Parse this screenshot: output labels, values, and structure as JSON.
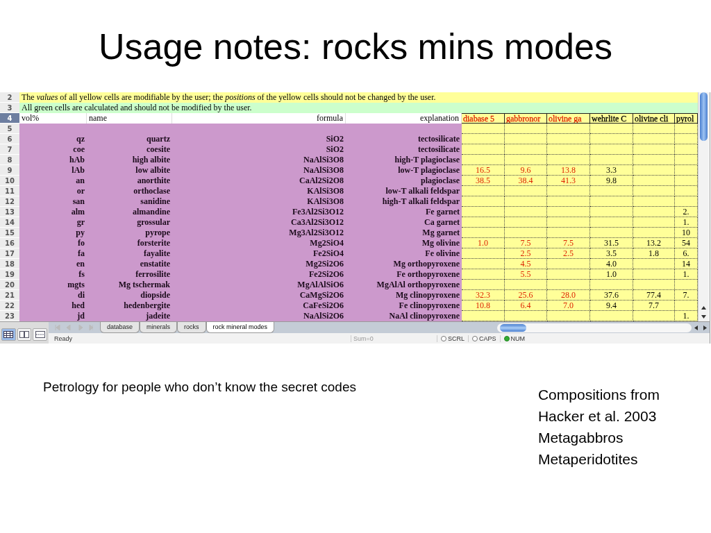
{
  "slide": {
    "title": "Usage notes: rocks mins modes",
    "caption": "Petrology for people who don’t know the secret codes",
    "side_notes": [
      "Compositions from",
      "Hacker et al. 2003",
      "Metagabbros",
      "Metaperidotites"
    ]
  },
  "sheet": {
    "notes": [
      {
        "row": "2",
        "kind": "yellow",
        "text": "The *values* of all yellow cells are modifiable by the user; the *positions* of the yellow cells should not be changed by the user."
      },
      {
        "row": "3",
        "kind": "green",
        "text": "All green cells are calculated and should not be modified by the user."
      }
    ],
    "header": {
      "row": "4",
      "selected": true,
      "cells": [
        "vol%",
        "name",
        "formula",
        "explanation"
      ],
      "modes": [
        {
          "label": "diabase 5",
          "color": "#dd2200"
        },
        {
          "label": "gabbronor",
          "color": "#dd2200"
        },
        {
          "label": "olivine ga",
          "color": "#dd2200"
        },
        {
          "label": "wehrlite C",
          "color": "#000000"
        },
        {
          "label": "olivine cli",
          "color": "#000000"
        },
        {
          "label": "pyrol",
          "color": "#000000"
        }
      ]
    },
    "rows": [
      {
        "row": "5",
        "modes": [
          {
            "kind": "blank"
          },
          {
            "kind": "blank"
          },
          {
            "kind": "blank"
          },
          {
            "kind": "blank"
          },
          {
            "kind": "blank"
          },
          {
            "kind": "blank"
          }
        ]
      },
      {
        "row": "6",
        "abbr": "qz",
        "name": "quartz",
        "formula": "SiO2",
        "explanation": "tectosilicate",
        "modes": [
          {
            "kind": "blank"
          },
          {
            "kind": "blank"
          },
          {
            "kind": "blank"
          },
          {
            "kind": "blank"
          },
          {
            "kind": "blank"
          },
          {
            "kind": "blank"
          }
        ]
      },
      {
        "row": "7",
        "abbr": "coe",
        "name": "coesite",
        "formula": "SiO2",
        "explanation": "tectosilicate",
        "modes": [
          {
            "kind": "blank"
          },
          {
            "kind": "blank"
          },
          {
            "kind": "blank"
          },
          {
            "kind": "blank"
          },
          {
            "kind": "blank"
          },
          {
            "kind": "blank"
          }
        ]
      },
      {
        "row": "8",
        "abbr": "hAb",
        "name": "high albite",
        "formula": "NaAlSi3O8",
        "explanation": "high-T plagioclase",
        "modes": [
          {
            "kind": "blank"
          },
          {
            "kind": "blank"
          },
          {
            "kind": "blank"
          },
          {
            "kind": "blank"
          },
          {
            "kind": "blank"
          },
          {
            "kind": "blank"
          }
        ]
      },
      {
        "row": "9",
        "abbr": "lAb",
        "name": "low albite",
        "formula": "NaAlSi3O8",
        "explanation": "low-T plagioclase",
        "modes": [
          {
            "kind": "number",
            "value": "16.5"
          },
          {
            "kind": "number",
            "value": "9.6"
          },
          {
            "kind": "number",
            "value": "13.8"
          },
          {
            "kind": "number",
            "value": "3.3"
          },
          {
            "kind": "blank"
          },
          {
            "kind": "blank"
          }
        ]
      },
      {
        "row": "10",
        "abbr": "an",
        "name": "anorthite",
        "formula": "CaAl2Si2O8",
        "explanation": "plagioclase",
        "modes": [
          {
            "kind": "number",
            "value": "38.5"
          },
          {
            "kind": "number",
            "value": "38.4"
          },
          {
            "kind": "number",
            "value": "41.3"
          },
          {
            "kind": "number",
            "value": "9.8"
          },
          {
            "kind": "blank"
          },
          {
            "kind": "blank"
          }
        ]
      },
      {
        "row": "11",
        "abbr": "or",
        "name": "orthoclase",
        "formula": "KAlSi3O8",
        "explanation": "low-T alkali feldspar",
        "modes": [
          {
            "kind": "blank"
          },
          {
            "kind": "blank"
          },
          {
            "kind": "blank"
          },
          {
            "kind": "blank"
          },
          {
            "kind": "blank"
          },
          {
            "kind": "blank"
          }
        ]
      },
      {
        "row": "12",
        "abbr": "san",
        "name": "sanidine",
        "formula": "KAlSi3O8",
        "explanation": "high-T alkali feldspar",
        "modes": [
          {
            "kind": "blank"
          },
          {
            "kind": "blank"
          },
          {
            "kind": "blank"
          },
          {
            "kind": "blank"
          },
          {
            "kind": "blank"
          },
          {
            "kind": "blank"
          }
        ]
      },
      {
        "row": "13",
        "abbr": "alm",
        "name": "almandine",
        "formula": "Fe3Al2Si3O12",
        "explanation": "Fe garnet",
        "modes": [
          {
            "kind": "blank"
          },
          {
            "kind": "blank"
          },
          {
            "kind": "blank"
          },
          {
            "kind": "blank"
          },
          {
            "kind": "blank"
          },
          {
            "kind": "number",
            "value": "2."
          }
        ]
      },
      {
        "row": "14",
        "abbr": "gr",
        "name": "grossular",
        "formula": "Ca3Al2Si3O12",
        "explanation": "Ca garnet",
        "modes": [
          {
            "kind": "blank"
          },
          {
            "kind": "blank"
          },
          {
            "kind": "blank"
          },
          {
            "kind": "blank"
          },
          {
            "kind": "blank"
          },
          {
            "kind": "number",
            "value": "1."
          }
        ]
      },
      {
        "row": "15",
        "abbr": "py",
        "name": "pyrope",
        "formula": "Mg3Al2Si3O12",
        "explanation": "Mg garnet",
        "modes": [
          {
            "kind": "blank"
          },
          {
            "kind": "blank"
          },
          {
            "kind": "blank"
          },
          {
            "kind": "blank"
          },
          {
            "kind": "blank"
          },
          {
            "kind": "number",
            "value": "10"
          }
        ]
      },
      {
        "row": "16",
        "abbr": "fo",
        "name": "forsterite",
        "formula": "Mg2SiO4",
        "explanation": "Mg olivine",
        "modes": [
          {
            "kind": "number",
            "value": "1.0"
          },
          {
            "kind": "number",
            "value": "7.5"
          },
          {
            "kind": "number",
            "value": "7.5"
          },
          {
            "kind": "number",
            "value": "31.5"
          },
          {
            "kind": "number",
            "value": "13.2"
          },
          {
            "kind": "number",
            "value": "54"
          }
        ]
      },
      {
        "row": "17",
        "abbr": "fa",
        "name": "fayalite",
        "formula": "Fe2SiO4",
        "explanation": "Fe olivine",
        "modes": [
          {
            "kind": "blank"
          },
          {
            "kind": "number",
            "value": "2.5"
          },
          {
            "kind": "number",
            "value": "2.5"
          },
          {
            "kind": "number",
            "value": "3.5"
          },
          {
            "kind": "number",
            "value": "1.8"
          },
          {
            "kind": "number",
            "value": "6."
          }
        ]
      },
      {
        "row": "18",
        "abbr": "en",
        "name": "enstatite",
        "formula": "Mg2Si2O6",
        "explanation": "Mg orthopyroxene",
        "modes": [
          {
            "kind": "blank"
          },
          {
            "kind": "number",
            "value": "4.5"
          },
          {
            "kind": "blank"
          },
          {
            "kind": "number",
            "value": "4.0"
          },
          {
            "kind": "blank"
          },
          {
            "kind": "number",
            "value": "14"
          }
        ]
      },
      {
        "row": "19",
        "abbr": "fs",
        "name": "ferrosilite",
        "formula": "Fe2Si2O6",
        "explanation": "Fe orthopyroxene",
        "modes": [
          {
            "kind": "blank"
          },
          {
            "kind": "number",
            "value": "5.5"
          },
          {
            "kind": "blank"
          },
          {
            "kind": "number",
            "value": "1.0"
          },
          {
            "kind": "blank"
          },
          {
            "kind": "number",
            "value": "1."
          }
        ]
      },
      {
        "row": "20",
        "abbr": "mgts",
        "name": "Mg tschermak",
        "formula": "MgAlAlSiO6",
        "explanation": "MgAlAl orthopyroxene",
        "modes": [
          {
            "kind": "blank"
          },
          {
            "kind": "blank"
          },
          {
            "kind": "blank"
          },
          {
            "kind": "blank"
          },
          {
            "kind": "blank"
          },
          {
            "kind": "blank"
          }
        ]
      },
      {
        "row": "21",
        "abbr": "di",
        "name": "diopside",
        "formula": "CaMgSi2O6",
        "explanation": "Mg clinopyroxene",
        "modes": [
          {
            "kind": "number",
            "value": "32.3"
          },
          {
            "kind": "number",
            "value": "25.6"
          },
          {
            "kind": "number",
            "value": "28.0"
          },
          {
            "kind": "number",
            "value": "37.6"
          },
          {
            "kind": "number",
            "value": "77.4"
          },
          {
            "kind": "number",
            "value": "7."
          }
        ]
      },
      {
        "row": "22",
        "abbr": "hed",
        "name": "hedenbergite",
        "formula": "CaFeSi2O6",
        "explanation": "Fe clinopyroxene",
        "modes": [
          {
            "kind": "number",
            "value": "10.8"
          },
          {
            "kind": "number",
            "value": "6.4"
          },
          {
            "kind": "number",
            "value": "7.0"
          },
          {
            "kind": "number",
            "value": "9.4"
          },
          {
            "kind": "number",
            "value": "7.7"
          },
          {
            "kind": "blank"
          }
        ]
      },
      {
        "row": "23",
        "abbr": "jd",
        "name": "jadeite",
        "formula": "NaAlSi2O6",
        "explanation": "NaAl clinopyroxene",
        "modes": [
          {
            "kind": "blank"
          },
          {
            "kind": "blank"
          },
          {
            "kind": "blank"
          },
          {
            "kind": "blank"
          },
          {
            "kind": "blank"
          },
          {
            "kind": "number",
            "value": "1."
          }
        ]
      }
    ],
    "view_buttons": [
      {
        "kind": "normal",
        "selected": true
      },
      {
        "kind": "layout",
        "selected": false
      },
      {
        "kind": "break",
        "selected": false
      }
    ],
    "sheet_tabs": [
      {
        "label": "database",
        "selected": false
      },
      {
        "label": "minerals",
        "selected": false
      },
      {
        "label": "rocks",
        "selected": false
      },
      {
        "label": "rock mineral modes",
        "selected": true
      }
    ],
    "status": {
      "text": "Ready",
      "sum": "Sum=0",
      "indicators": [
        {
          "label": "SCRL",
          "on": false
        },
        {
          "label": "CAPS",
          "on": false
        },
        {
          "label": "NUM",
          "on": true
        }
      ]
    }
  }
}
